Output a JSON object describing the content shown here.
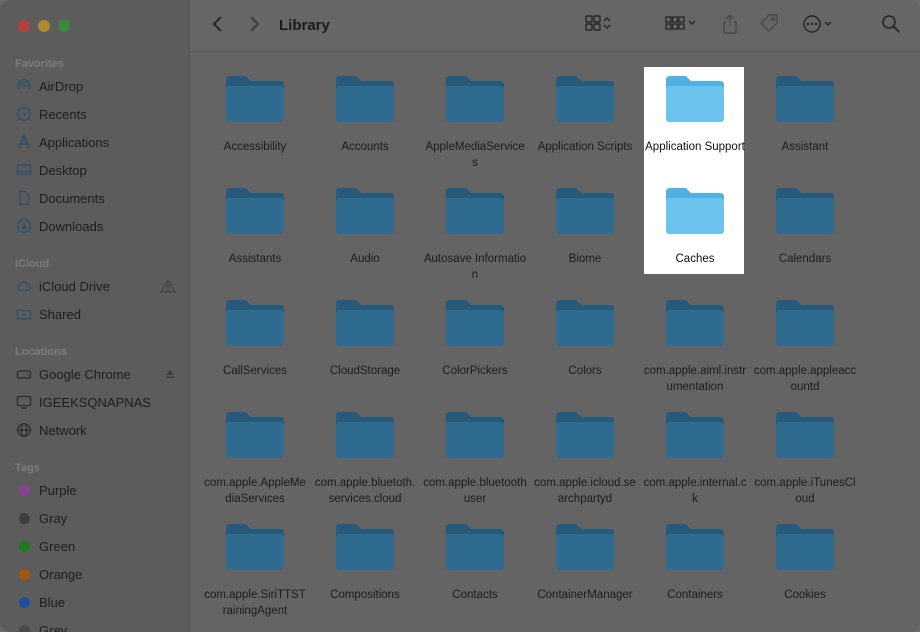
{
  "window": {
    "title": "Library"
  },
  "sidebar": {
    "favorites_title": "Favorites",
    "favorites": [
      {
        "label": "AirDrop",
        "icon": "airdrop-icon"
      },
      {
        "label": "Recents",
        "icon": "clock-icon"
      },
      {
        "label": "Applications",
        "icon": "applications-icon"
      },
      {
        "label": "Desktop",
        "icon": "desktop-icon"
      },
      {
        "label": "Documents",
        "icon": "document-icon"
      },
      {
        "label": "Downloads",
        "icon": "download-icon"
      }
    ],
    "icloud_title": "iCloud",
    "icloud": [
      {
        "label": "iCloud Drive",
        "icon": "cloud-icon"
      },
      {
        "label": "Shared",
        "icon": "shared-folder-icon"
      }
    ],
    "locations_title": "Locations",
    "locations": [
      {
        "label": "Google Chrome",
        "icon": "drive-icon"
      },
      {
        "label": "IGEEKSQNAPNAS",
        "icon": "monitor-icon"
      },
      {
        "label": "Network",
        "icon": "globe-icon"
      }
    ],
    "tags_title": "Tags",
    "tags": [
      {
        "label": "Purple",
        "color": "#8a3f8f"
      },
      {
        "label": "Gray",
        "color": "#3e3e3e"
      },
      {
        "label": "Green",
        "color": "#1e7a1e"
      },
      {
        "label": "Orange",
        "color": "#a8560a"
      },
      {
        "label": "Blue",
        "color": "#1f4f9c"
      },
      {
        "label": "Grey",
        "color": "#4a4a4a"
      }
    ]
  },
  "folders": [
    "Accessibility",
    "Accounts",
    "AppleMediaServices",
    "Application Scripts",
    "Application Support",
    "Assistant",
    "Assistants",
    "Audio",
    "Autosave Information",
    "Biome",
    "Caches",
    "Calendars",
    "CallServices",
    "CloudStorage",
    "ColorPickers",
    "Colors",
    "com.apple.aiml.instrumentation",
    "com.apple.appleaccountd",
    "com.apple.AppleMediaServices",
    "com.apple.bluetoth.services.cloud",
    "com.apple.bluetoothuser",
    "com.apple.icloud.searchpartyd",
    "com.apple.internal.ck",
    "com.apple.iTunesCloud",
    "com.apple.SiriTTSTrainingAgent",
    "Compositions",
    "Contacts",
    "ContainerManager",
    "Containers",
    "Cookies"
  ],
  "highlighted": [
    "Application Support",
    "Caches"
  ],
  "colors": {
    "folder_dim": "#2e6b8f",
    "folder_bright": "#6cc3ee"
  }
}
